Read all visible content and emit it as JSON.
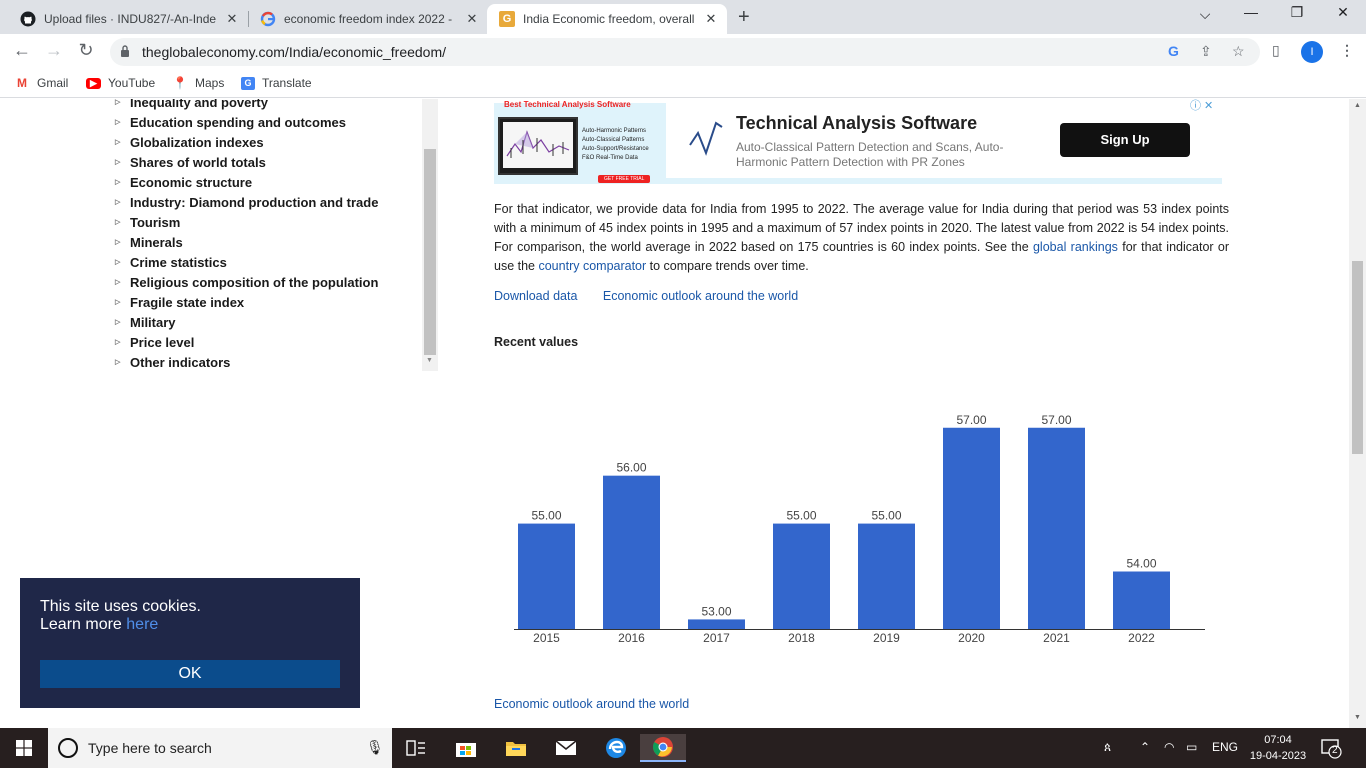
{
  "browser": {
    "tabs": [
      {
        "title": "Upload files · INDU827/-An-Inde",
        "active": false
      },
      {
        "title": "economic freedom index 2022 - ",
        "active": false
      },
      {
        "title": "India Economic freedom, overall ",
        "active": true
      }
    ],
    "url": "theglobaleconomy.com/India/economic_freedom/",
    "profile_initial": "I",
    "bookmarks": [
      {
        "label": "Gmail"
      },
      {
        "label": "YouTube"
      },
      {
        "label": "Maps"
      },
      {
        "label": "Translate"
      }
    ]
  },
  "sidebar": {
    "items": [
      "Inequality and poverty",
      "Education spending and outcomes",
      "Globalization indexes",
      "Shares of world totals",
      "Economic structure",
      "Industry: Diamond production and trade",
      "Tourism",
      "Minerals",
      "Crime statistics",
      "Religious composition of the population",
      "Fragile state index",
      "Military",
      "Price level",
      "Other indicators"
    ]
  },
  "ad": {
    "label": "Best Technical Analysis Software",
    "features": [
      "Auto-Harmonic Patterns",
      "Auto-Classical Patterns",
      "Auto-Support/Resistance",
      "F&O Real-Time Data"
    ],
    "cta": "GET FREE TRIAL",
    "title": "Technical Analysis Software",
    "subtitle": "Auto-Classical Pattern Detection and Scans, Auto-Harmonic Pattern Detection with PR Zones",
    "button": "Sign Up"
  },
  "main": {
    "para_1": "For that indicator, we provide data for India from 1995 to 2022. The average value for India during that period was 53 index points with a minimum of 45 index points in 1995 and a maximum of 57 index points in 2020. The latest value from 2022 is 54 index points. For comparison, the world average in 2022 based on 175 countries is 60 index points. See the ",
    "link_rankings": "global rankings",
    "para_2": " for that indicator or use the ",
    "link_comparator": "country comparator",
    "para_3": " to compare trends over time.",
    "download": "Download data",
    "outlook": "Economic outlook around the world",
    "recent_values": "Recent values",
    "bottom_link": "Economic outlook around the world"
  },
  "chart_data": {
    "type": "bar",
    "categories": [
      "2015",
      "2016",
      "2017",
      "2018",
      "2019",
      "2020",
      "2021",
      "2022"
    ],
    "values": [
      55.0,
      56.0,
      53.0,
      55.0,
      55.0,
      57.0,
      57.0,
      54.0
    ],
    "value_labels": [
      "55.00",
      "56.00",
      "53.00",
      "55.00",
      "55.00",
      "57.00",
      "57.00",
      "54.00"
    ],
    "ylim": [
      52.8,
      57.6
    ],
    "grid": false,
    "color": "#3366cc"
  },
  "cookie": {
    "line1": "This site uses cookies.",
    "line2": "Learn more ",
    "link": "here",
    "ok": "OK"
  },
  "taskbar": {
    "search_placeholder": "Type here to search",
    "lang": "ENG",
    "time": "07:04",
    "date": "19-04-2023",
    "notifications": "2"
  }
}
